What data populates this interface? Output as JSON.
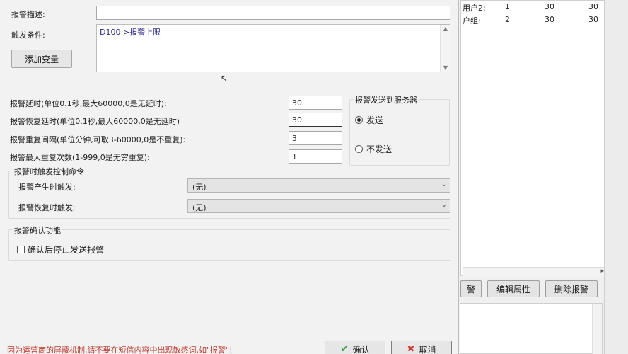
{
  "background_table": {
    "rows": [
      {
        "name": "用户2:",
        "num": "1",
        "a": "30",
        "b": "30"
      },
      {
        "name": "户组:",
        "num": "2",
        "a": "30",
        "b": "30"
      }
    ],
    "buttons": [
      "警",
      "编辑属性",
      "删除报警"
    ]
  },
  "dialog": {
    "description_label": "报警描述:",
    "trigger_label": "触发条件:",
    "trigger_text": "D100 >报警上限",
    "add_variable_button": "添加变量",
    "delay_label": "报警延时(单位0.1秒,最大60000,0是无延时):",
    "delay_value": "30",
    "recover_delay_label": "报警恢复延时(单位0.1秒,最大60000,0是无延时)",
    "recover_delay_value": "30",
    "repeat_interval_label": "报警重复间隔(单位分钟,可取3-60000,0是不重复):",
    "repeat_interval_value": "3",
    "max_repeat_label": "报警最大重复次数(1-999,0是无穷重复):",
    "max_repeat_value": "1",
    "send_group_title": "报警发送到服务器",
    "send_option": "发送",
    "no_send_option": "不发送",
    "trigger_group_title": "报警时触发控制命令",
    "on_alarm_label": "报警产生时触发:",
    "on_alarm_value": "(无)",
    "on_recover_label": "报警恢复时触发:",
    "on_recover_value": "(无)",
    "confirm_group_title": "报警确认功能",
    "stop_after_confirm_label": "确认后停止发送报警",
    "warning_text": "因为运营商的屏蔽机制,请不要在短信内容中出现敏感词,如\"报警\"!",
    "ok_button": "确认",
    "cancel_button": "取消"
  }
}
